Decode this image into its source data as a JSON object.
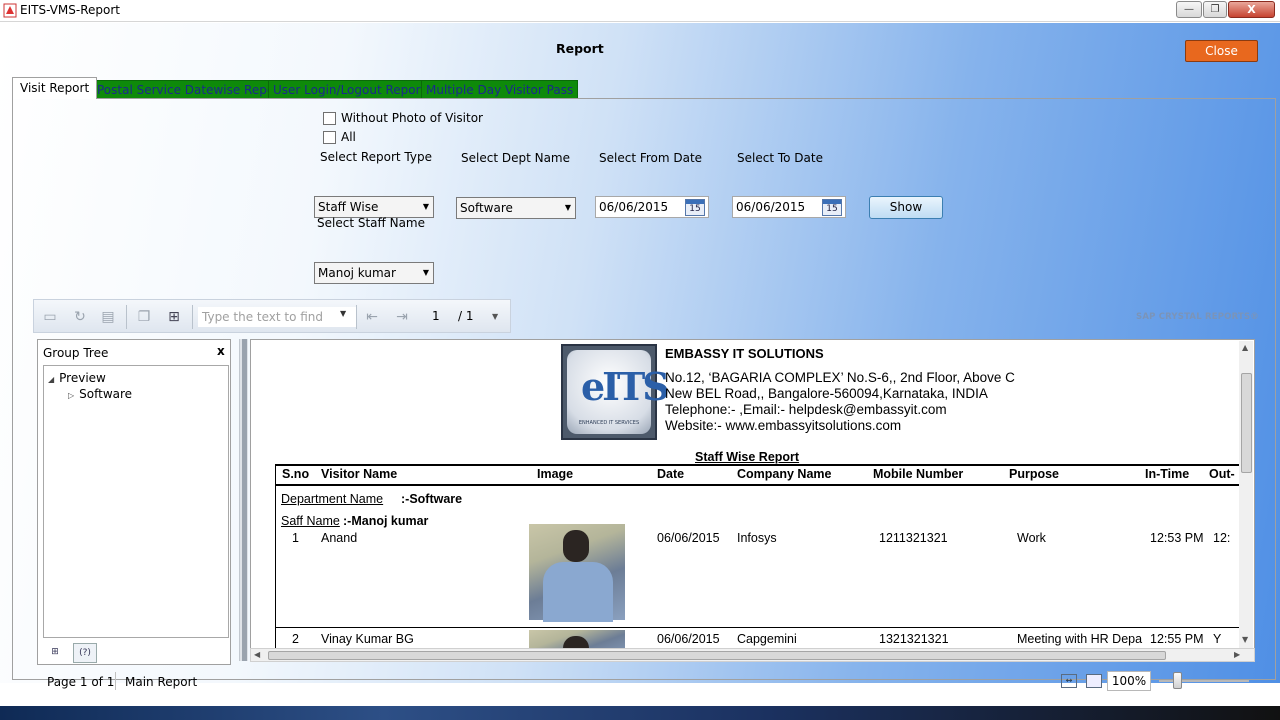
{
  "window": {
    "title": "EITS-VMS-Report",
    "min_label": "—",
    "max_label": "❐",
    "close_label": "X"
  },
  "header": {
    "title": "Report",
    "close_label": "Close"
  },
  "tabs": [
    {
      "label": "Visit Report",
      "active": true
    },
    {
      "label": "Postal Service Datewise Report",
      "active": false
    },
    {
      "label": "User Login/Logout Report",
      "active": false
    },
    {
      "label": "Multiple Day Visitor Pass",
      "active": false
    }
  ],
  "filters": {
    "without_photo_label": "Without Photo of Visitor",
    "all_label": "All",
    "report_type_label": "Select Report Type",
    "report_type_value": "Staff Wise",
    "dept_label": "Select Dept Name",
    "dept_value": "Software",
    "from_label": "Select From Date",
    "from_value": "06/06/2015",
    "to_label": "Select To Date",
    "to_value": "06/06/2015",
    "staff_label": "Select Staff Name",
    "staff_value": "Manoj kumar",
    "show_label": "Show",
    "calendar_day": "15"
  },
  "viewer_toolbar": {
    "find_placeholder": "Type the text to find",
    "page_current": "1",
    "page_total": "/ 1",
    "brand": "SAP CRYSTAL REPORTS®"
  },
  "group_tree": {
    "title": "Group Tree",
    "close_label": "x",
    "root": "Preview",
    "child": "Software"
  },
  "report": {
    "logo_text": "eITS",
    "logo_tagline": "ENHANCED IT SERVICES",
    "company": "EMBASSY IT SOLUTIONS",
    "address1": "No.12, ‘BAGARIA COMPLEX’ No.S-6,, 2nd Floor, Above C",
    "address2": "New BEL Road,, Bangalore-560094,Karnataka, INDIA",
    "telephone": "Telephone:- ,Email:- helpdesk@embassyit.com",
    "website": "Website:- www.embassyitsolutions.com",
    "title": "Staff Wise Report",
    "columns": [
      "S.no",
      "Visitor Name",
      "Image",
      "Date",
      "Company Name",
      "Mobile Number",
      "Purpose",
      "In-Time",
      "Out-"
    ],
    "department_label": "Department Name",
    "department_value": ":-Software",
    "staff_label": "Saff Name",
    "staff_value": ":-Manoj kumar",
    "rows": [
      {
        "sno": "1",
        "name": "Anand",
        "date": "06/06/2015",
        "company": "Infosys",
        "mobile": "1211321321",
        "purpose": "Work",
        "in_time": "12:53 PM",
        "out_time": "12:"
      },
      {
        "sno": "2",
        "name": "Vinay Kumar BG",
        "date": "06/06/2015",
        "company": "Capgemini",
        "mobile": "1321321321",
        "purpose": "Meeting with HR Depa",
        "in_time": "12:55 PM",
        "out_time": "Y"
      }
    ]
  },
  "status": {
    "page": "Page 1 of 1",
    "main": "Main Report",
    "zoom": "100%"
  },
  "colors": {
    "close_button": "#e8681e",
    "tab_inactive": "#0e8a0a",
    "tab_text": "#1b2a8a",
    "gradient_end": "#4f8fe5"
  }
}
